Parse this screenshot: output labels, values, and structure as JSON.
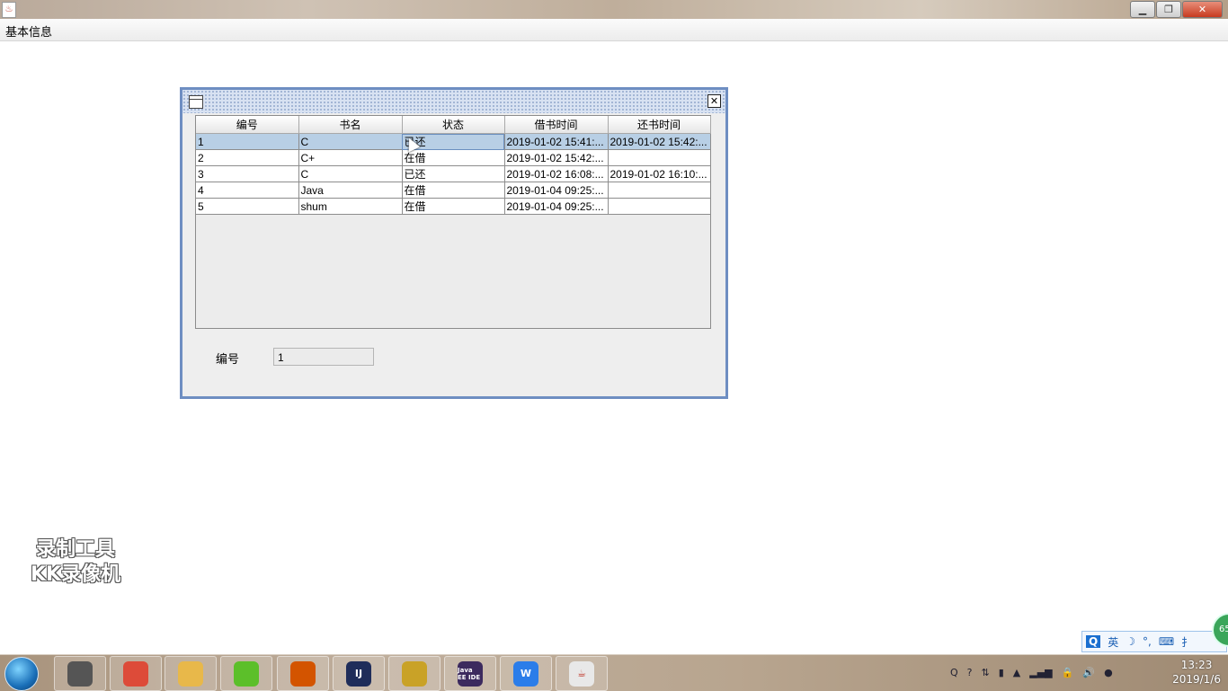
{
  "window": {
    "app_icon": "java-icon",
    "buttons": [
      "minimize",
      "restore",
      "close"
    ]
  },
  "menu": {
    "items": [
      "基本信息"
    ]
  },
  "table": {
    "columns": [
      "编号",
      "书名",
      "状态",
      "借书时间",
      "还书时间"
    ],
    "rows": [
      [
        "1",
        "C",
        "已还",
        "2019-01-02 15:41:...",
        "2019-01-02 15:42:..."
      ],
      [
        "2",
        "C+",
        "在借",
        "2019-01-02 15:42:...",
        ""
      ],
      [
        "3",
        "C",
        "已还",
        "2019-01-02 16:08:...",
        "2019-01-02 16:10:..."
      ],
      [
        "4",
        "Java",
        "在借",
        "2019-01-04 09:25:...",
        ""
      ],
      [
        "5",
        "shum",
        "在借",
        "2019-01-04 09:25:...",
        ""
      ]
    ],
    "selected_row": 0
  },
  "form": {
    "id_label": "编号",
    "id_value": "1"
  },
  "watermark": {
    "line1": "录制工具",
    "line2": "KK录像机"
  },
  "ime": {
    "logo": "Q",
    "mode": "英",
    "items": [
      "☽",
      "°,",
      "⌨",
      "⺘"
    ]
  },
  "badge": "65",
  "taskbar": {
    "apps": [
      {
        "name": "media-app",
        "label": "",
        "color": "#555555"
      },
      {
        "name": "chrome",
        "label": "",
        "color": "#dd4b39"
      },
      {
        "name": "file-explorer",
        "label": "",
        "color": "#e8b84a"
      },
      {
        "name": "green-app",
        "label": "",
        "color": "#5cbf2a"
      },
      {
        "name": "red-app",
        "label": "",
        "color": "#d35400"
      },
      {
        "name": "intellij",
        "label": "IJ",
        "color": "#1f2d5a"
      },
      {
        "name": "tools",
        "label": "",
        "color": "#c9a227"
      },
      {
        "name": "java-ee-ide",
        "label": "Java EE IDE",
        "color": "#3c2a5e"
      },
      {
        "name": "wps",
        "label": "W",
        "color": "#2b7de9"
      },
      {
        "name": "java",
        "label": "☕",
        "color": "#e8e8e8"
      }
    ],
    "tray": [
      "Q",
      "?",
      "⇅",
      "▮",
      "▲",
      "▂▄▆",
      "🔒",
      "🔊",
      "●"
    ],
    "time": "13:23",
    "date": "2019/1/6"
  }
}
